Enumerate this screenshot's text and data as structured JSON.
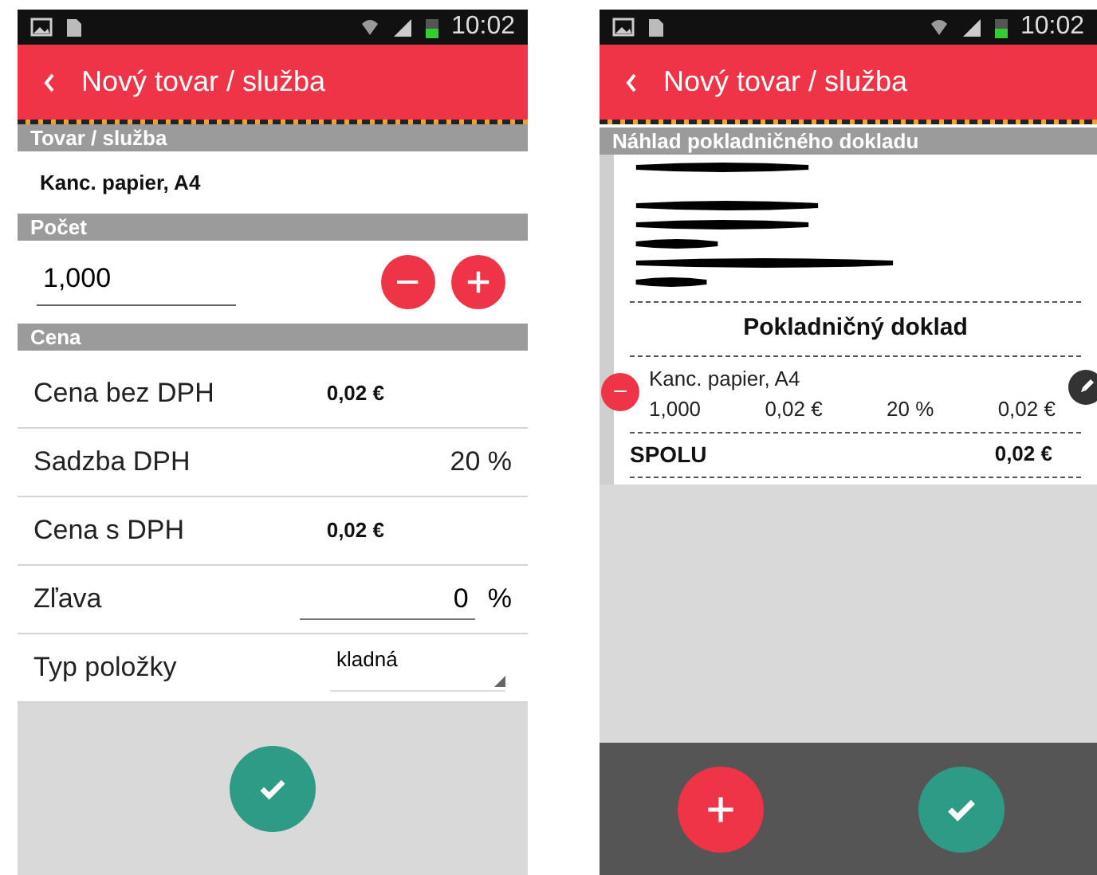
{
  "editor": {
    "status_bar": {
      "time": "10:02"
    },
    "title": "Nový tovar / služba",
    "item_section": "Tovar / služba",
    "item_name": "Kanc. papier, A4",
    "quantity_section": "Počet",
    "quantity": "1,000",
    "price_section": "Cena",
    "rows": [
      {
        "kind": "value",
        "label": "Cena bez DPH",
        "value": "0,02 €",
        "bold": true
      },
      {
        "kind": "value",
        "label": "Sadzba DPH",
        "value": "20 %",
        "bold": false
      },
      {
        "kind": "value",
        "label": "Cena s DPH",
        "value": "0,02 €",
        "bold": true
      },
      {
        "kind": "input",
        "label": "Zľava",
        "value": "0",
        "unit": "%"
      },
      {
        "kind": "select",
        "label": "Typ položky",
        "value": "kladná"
      }
    ]
  },
  "preview": {
    "status_bar": {
      "time": "10:02"
    },
    "title": "Nový tovar / služba",
    "section": "Náhlad pokladničného dokladu",
    "receipt_title": "Pokladničný doklad",
    "items": [
      {
        "name": "Kanc. papier, A4",
        "quantity": "1,000",
        "price": "0,02 €",
        "vat": "20 %",
        "total": "0,02 €"
      }
    ],
    "total_label": "SPOLU",
    "total": "0,02 €"
  }
}
